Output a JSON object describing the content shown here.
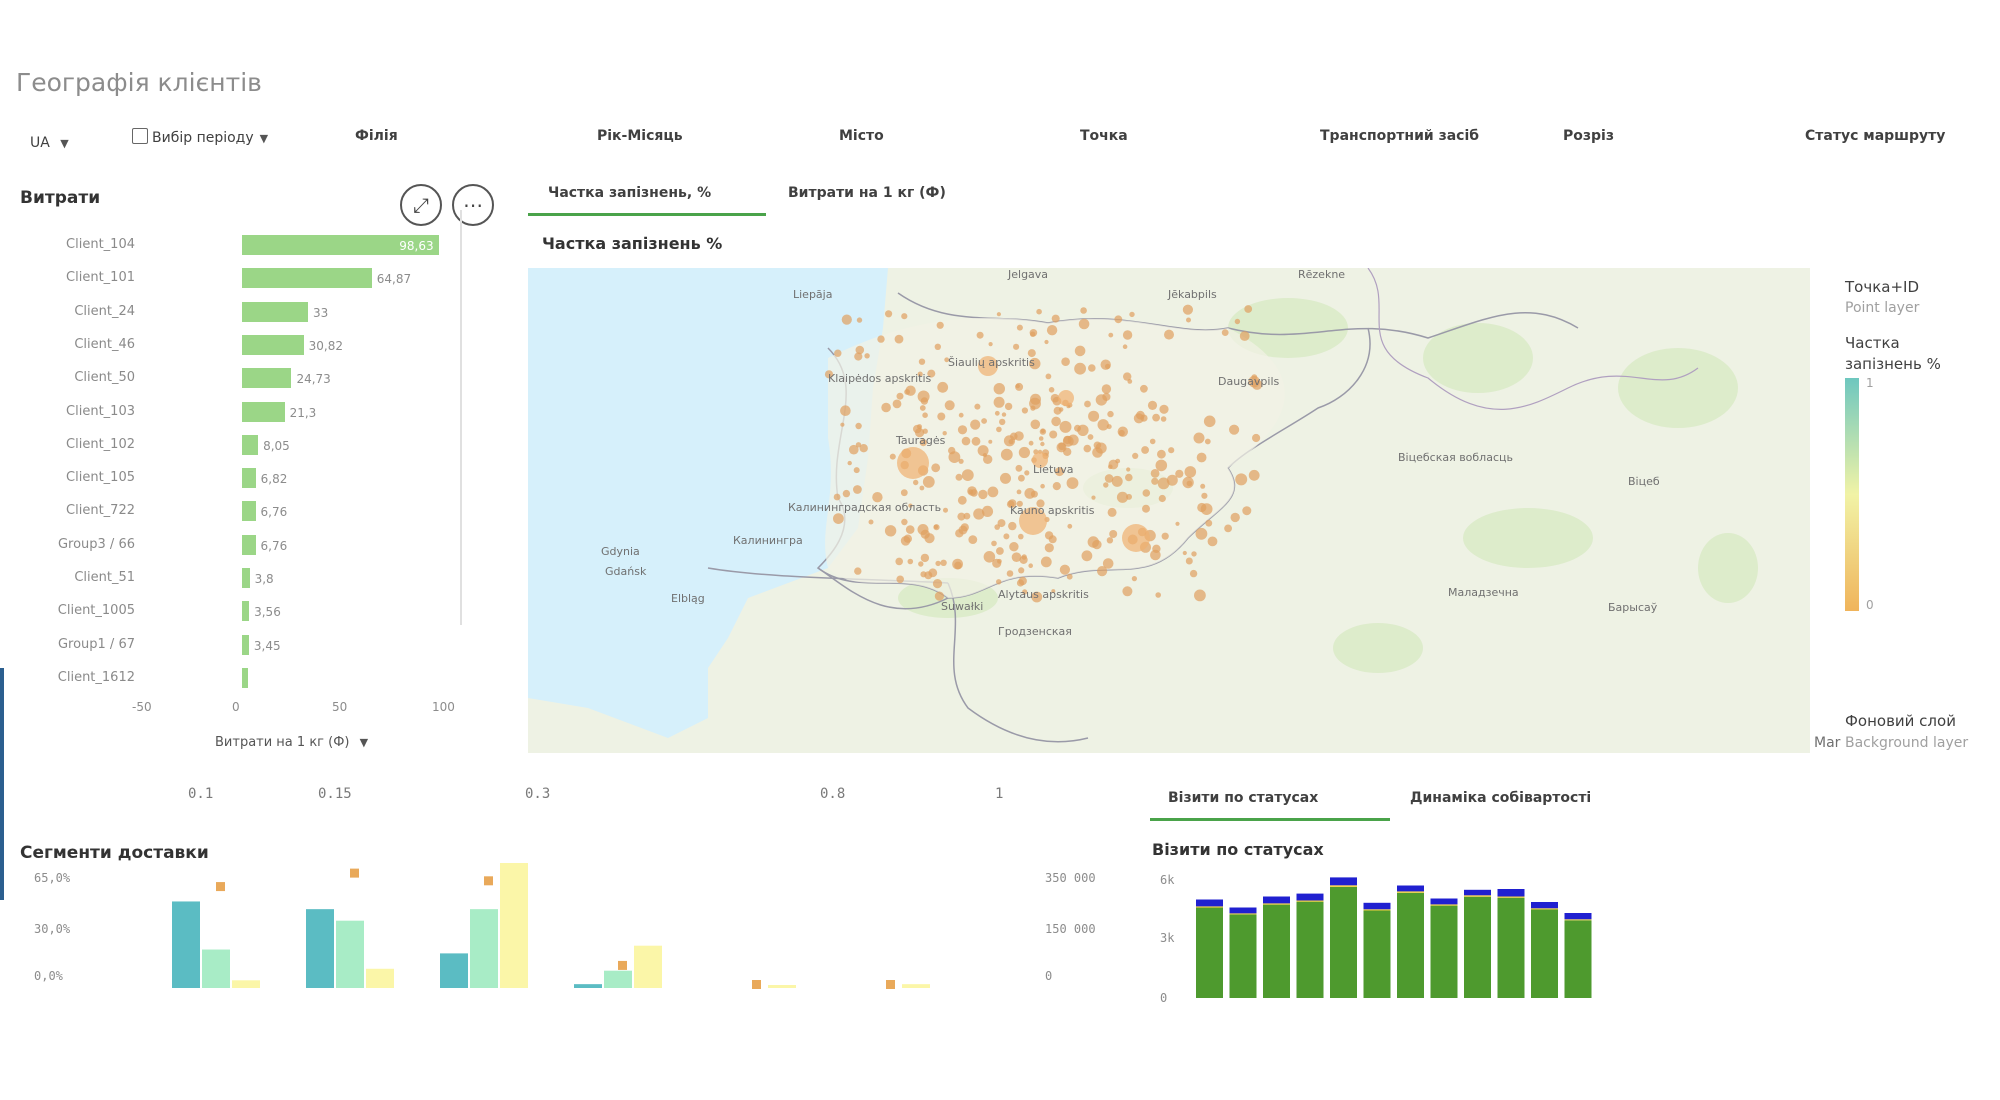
{
  "page": {
    "title": "Географія клієнтів",
    "language": "UA"
  },
  "filters": {
    "period": "Вибір періоду",
    "branch": "Філія",
    "year_month": "Рік-Місяць",
    "city": "Місто",
    "point": "Точка",
    "vehicle": "Транспортний засіб",
    "slice": "Розріз",
    "route_status": "Статус маршруту"
  },
  "expenses": {
    "title": "Витрати",
    "expand_icon": "expand-icon",
    "more_icon": "more-icon",
    "dimension_label": "Витрати на 1 кг (Ф)",
    "axis_ticks": [
      "-50",
      "0",
      "50",
      "100"
    ],
    "chart_data": {
      "type": "bar",
      "orientation": "horizontal",
      "categories": [
        "Client_104",
        "Client_101",
        "Client_24",
        "Client_46",
        "Client_50",
        "Client_103",
        "Client_102",
        "Client_105",
        "Client_722",
        "Group3 / 66",
        "Client_51",
        "Client_1005",
        "Group1 / 67",
        "Client_1612"
      ],
      "values": [
        98.63,
        64.87,
        33,
        30.82,
        24.73,
        21.3,
        8.05,
        6.82,
        6.76,
        6.76,
        3.8,
        3.56,
        3.45,
        3.2
      ],
      "value_labels": [
        "98,63",
        "64,87",
        "33",
        "30,82",
        "24,73",
        "21,3",
        "8,05",
        "6,82",
        "6,76",
        "6,76",
        "3,8",
        "3,56",
        "3,45",
        ""
      ],
      "xlim": [
        -50,
        100
      ]
    }
  },
  "map_section": {
    "tabs": [
      "Частка запізнень, %",
      "Витрати на 1 кг (Ф)"
    ],
    "title": "Частка запізнень %",
    "legend": {
      "layer_title": "Точка+ID",
      "layer_sub": "Point layer",
      "metric_title_1": "Частка",
      "metric_title_2": "запізнень %",
      "max": "1",
      "min": "0",
      "background_title": "Фоновий слой",
      "background_sub": "Background layer",
      "mar": "Mar"
    },
    "place_labels": [
      "Jelgava",
      "Rēzekne",
      "Liepāja",
      "Jēkabpils",
      "Daugavpils",
      "Lietuva",
      "Калинингра",
      "Калининградская область",
      "Gdynia",
      "Gdańsk",
      "Elbląg",
      "Suwałki",
      "Барысаў",
      "Маладзечна",
      "Віцеб",
      "Віцебская вобласць",
      "Гродзенская",
      "Alytaus apskritis",
      "Kauno apskritis",
      "Klaipėdos apskritis",
      "Tauragės",
      "Šiaulių apskritis"
    ],
    "colors": {
      "sea": "#d6f0fb",
      "land": "#eef2e4",
      "bubble": "#e0a060"
    }
  },
  "bottom_axis_ticks": [
    "0.1",
    "0.15",
    "0.3",
    "0.8",
    "1"
  ],
  "delivery_segments": {
    "title": "Сегменти доставки",
    "left_axis": [
      "65,0%",
      "30,0%",
      "0,0%"
    ],
    "right_axis": [
      "350 000",
      "150 000",
      "0"
    ],
    "chart_data": {
      "type": "bar",
      "groups": 6,
      "series": [
        {
          "color": "#5bbcc3",
          "values": [
            0.45,
            0.41,
            0.18,
            0.02,
            0,
            0
          ]
        },
        {
          "color": "#a8ecc6",
          "values": [
            0.2,
            0.35,
            0.41,
            0.09,
            0,
            0
          ]
        },
        {
          "color": "#fbf6a8",
          "values": [
            0.04,
            0.1,
            0.65,
            0.22,
            0.01,
            0.02
          ]
        }
      ],
      "markers": [
        0.53,
        0.6,
        0.56,
        0.12,
        0,
        0
      ],
      "marker_color": "#e9a95a",
      "ylim_left": [
        0,
        0.65
      ],
      "ylim_right": [
        0,
        350000
      ]
    }
  },
  "visits": {
    "tabs": [
      "Візити по статусах",
      "Динаміка собівартості"
    ],
    "title": "Візити по статусах",
    "axis": [
      "6k",
      "3k",
      "0"
    ],
    "chart_data": {
      "type": "bar",
      "stacked": true,
      "ylim": [
        0,
        6000
      ],
      "series": [
        {
          "color": "#4e9a2e",
          "values": [
            4600,
            4250,
            4750,
            4900,
            5650,
            4450,
            5350,
            4700,
            5150,
            5100,
            4500,
            3950
          ]
        },
        {
          "color": "#f4d03f",
          "values": [
            60,
            50,
            60,
            60,
            80,
            60,
            70,
            60,
            70,
            60,
            60,
            50
          ]
        },
        {
          "color": "#2020d0",
          "values": [
            350,
            300,
            350,
            350,
            400,
            330,
            300,
            300,
            280,
            380,
            320,
            320
          ]
        }
      ]
    }
  }
}
